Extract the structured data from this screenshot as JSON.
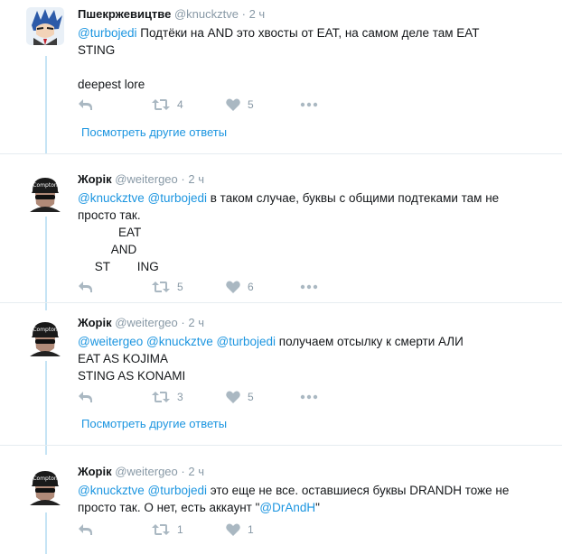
{
  "tweets": [
    {
      "name": "Пшекржевицтве",
      "handle": "@knuckztve",
      "dot": "·",
      "time": "2 ч",
      "text_lines": [
        [
          {
            "type": "mention",
            "text": "@turbojedi"
          },
          {
            "type": "text",
            "text": " Подтёки на AND это хвосты от EAT, на самом деле там EAT"
          }
        ],
        [
          {
            "type": "text",
            "text": "STING"
          }
        ],
        [],
        [
          {
            "type": "text",
            "text": "deepest lore"
          }
        ]
      ],
      "retweets": "4",
      "likes": "5",
      "show_more": "Посмотреть другие ответы"
    },
    {
      "name": "Жорік",
      "handle": "@weitergeo",
      "dot": "·",
      "time": "2 ч",
      "text_lines": [
        [
          {
            "type": "mention",
            "text": "@knuckztve"
          },
          {
            "type": "text",
            "text": " "
          },
          {
            "type": "mention",
            "text": "@turbojedi"
          },
          {
            "type": "text",
            "text": " в таком случае, буквы с общими подтеками там не"
          }
        ],
        [
          {
            "type": "text",
            "text": "просто так."
          }
        ],
        [
          {
            "type": "pre",
            "text": "            EAT"
          }
        ],
        [
          {
            "type": "pre",
            "text": "          AND"
          }
        ],
        [
          {
            "type": "pre",
            "text": "     ST        ING"
          }
        ]
      ],
      "retweets": "5",
      "likes": "6"
    },
    {
      "name": "Жорік",
      "handle": "@weitergeo",
      "dot": "·",
      "time": "2 ч",
      "text_lines": [
        [
          {
            "type": "mention",
            "text": "@weitergeo"
          },
          {
            "type": "text",
            "text": " "
          },
          {
            "type": "mention",
            "text": "@knuckztve"
          },
          {
            "type": "text",
            "text": " "
          },
          {
            "type": "mention",
            "text": "@turbojedi"
          },
          {
            "type": "text",
            "text": " получаем отсылку к смерти АЛИ"
          }
        ],
        [
          {
            "type": "text",
            "text": "EAT AS KOJIMA"
          }
        ],
        [
          {
            "type": "text",
            "text": "STING AS KONAMI"
          }
        ]
      ],
      "retweets": "3",
      "likes": "5",
      "show_more": "Посмотреть другие ответы"
    },
    {
      "name": "Жорік",
      "handle": "@weitergeo",
      "dot": "·",
      "time": "2 ч",
      "text_lines": [
        [
          {
            "type": "mention",
            "text": "@knuckztve"
          },
          {
            "type": "text",
            "text": " "
          },
          {
            "type": "mention",
            "text": "@turbojedi"
          },
          {
            "type": "text",
            "text": " это еще не все. оставшиеся буквы DRANDH тоже не"
          }
        ],
        [
          {
            "type": "text",
            "text": "просто так. О нет, есть аккаунт \""
          },
          {
            "type": "mention",
            "text": "@DrAndH"
          },
          {
            "type": "text",
            "text": "\""
          }
        ]
      ],
      "retweets": "1",
      "likes": "1"
    }
  ],
  "icons": {
    "reply": "reply-icon",
    "retweet": "retweet-icon",
    "like": "heart-icon",
    "more": "more-dots-icon"
  },
  "colors": {
    "link": "#1b95e0",
    "thread_line": "#c6e4f5",
    "muted": "#8899a6",
    "icon": "#aab8c2",
    "separator": "#e6ecf0"
  }
}
